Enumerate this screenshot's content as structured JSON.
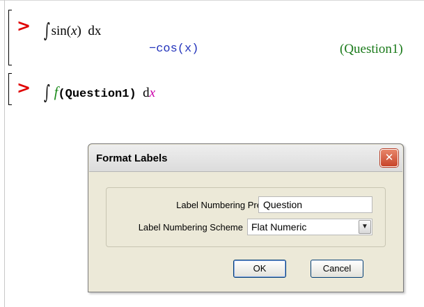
{
  "worksheet": {
    "group1": {
      "prompt": ">",
      "input": {
        "integral_sign": "∫",
        "func": "sin",
        "var": "x",
        "differential": "dx"
      },
      "output": {
        "result": "−cos(x)",
        "label": "(Question1)"
      }
    },
    "group2": {
      "prompt": ">",
      "input": {
        "integral_sign": "∫",
        "func": "f",
        "arg": "(Question1)",
        "d": "d",
        "var": "x"
      }
    }
  },
  "dialog": {
    "title": "Format Labels",
    "close_glyph": "✕",
    "prefix_label": "Label Numbering Prefix",
    "prefix_value": "Question",
    "scheme_label": "Label Numbering Scheme",
    "scheme_value": "Flat Numeric",
    "dropdown_glyph": "▼",
    "ok_label": "OK",
    "cancel_label": "Cancel"
  },
  "colors": {
    "prompt": "#e00000",
    "output": "#2233bb",
    "label": "#1a7a1a",
    "function_name": "#1a8a1a",
    "variable": "#cc00aa",
    "close_button": "#c7442a"
  }
}
